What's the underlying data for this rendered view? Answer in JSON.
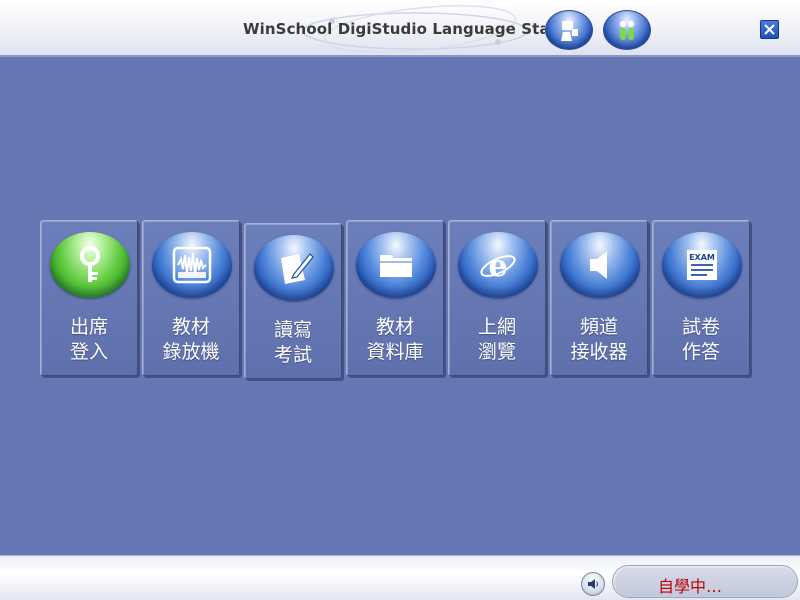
{
  "header": {
    "title": "WinSchool DigiStudio Language Statio",
    "teacher_icon": "teacher-icon",
    "students_icon": "students-icon",
    "close_icon": "close-icon"
  },
  "tiles": [
    {
      "line1": "出席",
      "line2": "登入",
      "icon": "key-icon",
      "orb": "green"
    },
    {
      "line1": "教材",
      "line2": "錄放機",
      "icon": "waveform-icon",
      "orb": "blue"
    },
    {
      "line1": "讀寫",
      "line2": "考試",
      "icon": "pen-paper-icon",
      "orb": "blue"
    },
    {
      "line1": "教材",
      "line2": "資料庫",
      "icon": "folder-icon",
      "orb": "blue"
    },
    {
      "line1": "上網",
      "line2": "瀏覽",
      "icon": "browser-icon",
      "orb": "blue"
    },
    {
      "line1": "頻道",
      "line2": "接收器",
      "icon": "speaker-icon",
      "orb": "blue"
    },
    {
      "line1": "試卷",
      "line2": "作答",
      "icon": "exam-icon",
      "orb": "blue",
      "icon_text": "EXAM"
    }
  ],
  "footer": {
    "status": "自學中…",
    "volume_icon": "volume-icon"
  },
  "colors": {
    "background": "#6677b3",
    "status_text": "#c00000",
    "orb_blue": "#2f5fc4",
    "orb_green": "#5cc83c"
  }
}
